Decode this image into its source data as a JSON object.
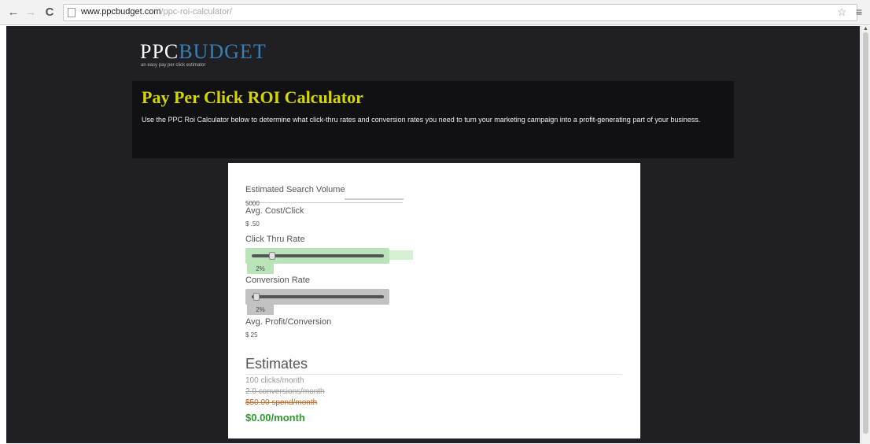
{
  "browser": {
    "url_host": "www.ppcbudget.com",
    "url_path": "/ppc-roi-calculator/"
  },
  "site": {
    "logo_ppc": "PPC",
    "logo_budget": "BUDGET",
    "tagline": "an easy pay per click estimator"
  },
  "hero": {
    "title": "Pay Per Click ROI Calculator",
    "intro": "Use the PPC Roi Calculator below to determine what click-thru rates and conversion rates you need to turn your marketing campaign into a profit-generating part of your business."
  },
  "calculator": {
    "search_volume_label": "Estimated Search Volume",
    "search_volume_value": "5000",
    "cost_per_click_label": "Avg. Cost/Click",
    "cost_per_click_value": "$ .50",
    "ctr_label": "Click Thru Rate",
    "ctr_value": "2%",
    "conversion_label": "Conversion Rate",
    "conversion_value": "2%",
    "profit_label": "Avg. Profit/Conversion",
    "profit_value": "$ 25"
  },
  "estimates": {
    "title": "Estimates",
    "clicks": "100 clicks/month",
    "conversions": "2.0 conversions/month",
    "spend": "$50.00 spend/month",
    "profit": "$0.00/month"
  },
  "colors": {
    "page_bg": "#1f1f24",
    "title": "#d4d600",
    "profit": "#2c9a2c"
  }
}
